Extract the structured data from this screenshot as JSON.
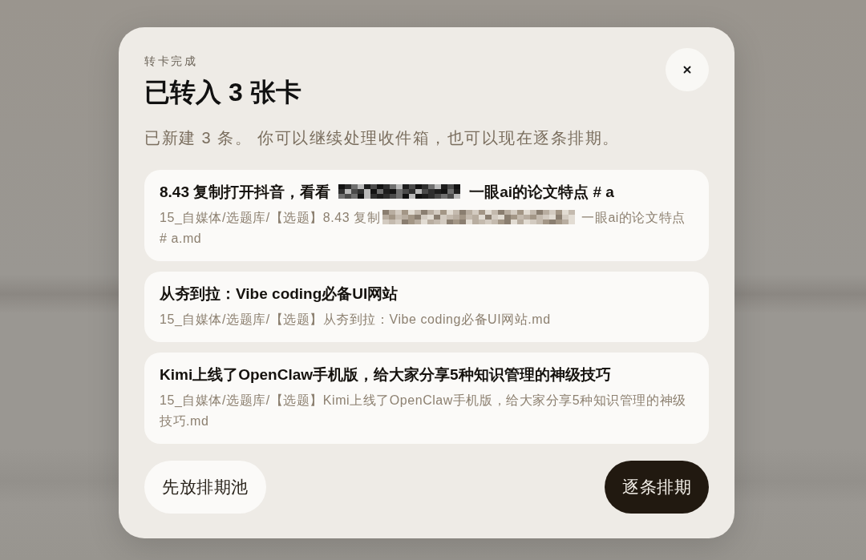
{
  "dialog": {
    "eyebrow": "转卡完成",
    "title": "已转入 3 张卡",
    "description": "已新建 3 条。 你可以继续处理收件箱，也可以现在逐条排期。",
    "cards": [
      {
        "title": [
          {
            "kind": "text",
            "text": "8.43 复制打开抖音，看看"
          },
          {
            "kind": "redacted"
          },
          {
            "kind": "text",
            "text": "一眼ai的论文特点 # a"
          }
        ],
        "path": [
          {
            "kind": "text",
            "text": "15_自媒体/选题库/【选题】8.43 复制"
          },
          {
            "kind": "redacted"
          },
          {
            "kind": "text",
            "text": "一眼ai的论文特点"
          },
          {
            "kind": "text",
            "text": "# a.md"
          }
        ]
      },
      {
        "title": [
          {
            "kind": "text",
            "text": "从夯到拉：Vibe coding必备UI网站"
          }
        ],
        "path": [
          {
            "kind": "text",
            "text": "15_自媒体/选题库/【选题】从夯到拉：Vibe coding必备UI网站.md"
          }
        ]
      },
      {
        "title": [
          {
            "kind": "text",
            "text": "Kimi上线了OpenClaw手机版，给大家分享5种知识管理的神级技巧"
          }
        ],
        "path": [
          {
            "kind": "text",
            "text": "15_自媒体/选题库/【选题】Kimi上线了OpenClaw手机版，给大家分享5种知识管理的神级技巧.md"
          }
        ]
      }
    ],
    "buttons": [
      {
        "kind": "secondary",
        "label": "先放排期池"
      },
      {
        "kind": "primary",
        "label": "逐条排期"
      }
    ]
  }
}
